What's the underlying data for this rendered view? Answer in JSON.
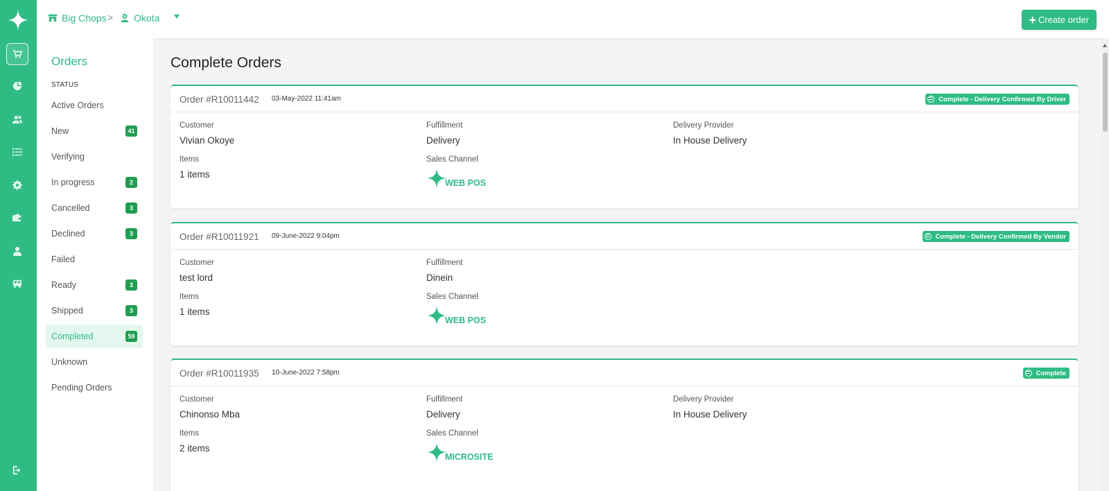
{
  "topbar": {
    "store": "Big Chops",
    "branch": "Okota",
    "create_label": "Create order"
  },
  "sidebar": {
    "title": "Orders",
    "section": "STATUS",
    "items": [
      {
        "label": "Active Orders",
        "count": null
      },
      {
        "label": "New",
        "count": "41"
      },
      {
        "label": "Verifying",
        "count": null
      },
      {
        "label": "In progress",
        "count": "2"
      },
      {
        "label": "Cancelled",
        "count": "3"
      },
      {
        "label": "Declined",
        "count": "3"
      },
      {
        "label": "Failed",
        "count": null
      },
      {
        "label": "Ready",
        "count": "3"
      },
      {
        "label": "Shipped",
        "count": "3"
      },
      {
        "label": "Completed",
        "count": "59"
      },
      {
        "label": "Unknown",
        "count": null
      },
      {
        "label": "Pending Orders",
        "count": null
      }
    ]
  },
  "main": {
    "title": "Complete Orders",
    "labels": {
      "customer": "Customer",
      "fulfillment": "Fulfillment",
      "delivery_provider": "Delivery Provider",
      "items": "Items",
      "sales_channel": "Sales Channel"
    },
    "orders": [
      {
        "number": "Order #R10011442",
        "date": "03-May-2022 11:41am",
        "status": "Complete - Delivery Confirmed By Driver",
        "customer": "Vivian Okoye",
        "fulfillment": "Delivery",
        "delivery_provider": "In House Delivery",
        "items": "1 items",
        "channel": "WEB POS"
      },
      {
        "number": "Order #R10011921",
        "date": "09-June-2022 9:04pm",
        "status": "Complete - Delivery Confirmed By Vendor",
        "customer": "test lord",
        "fulfillment": "Dinein",
        "items": "1 items",
        "channel": "WEB POS"
      },
      {
        "number": "Order #R10011935",
        "date": "10-June-2022 7:58pm",
        "status": "Complete",
        "customer": "Chinonso Mba",
        "fulfillment": "Delivery",
        "delivery_provider": "In House Delivery",
        "items": "2 items",
        "channel": "MICROSITE"
      }
    ]
  },
  "colors": {
    "accent": "#2fbc84",
    "badge": "#1f9e50"
  }
}
